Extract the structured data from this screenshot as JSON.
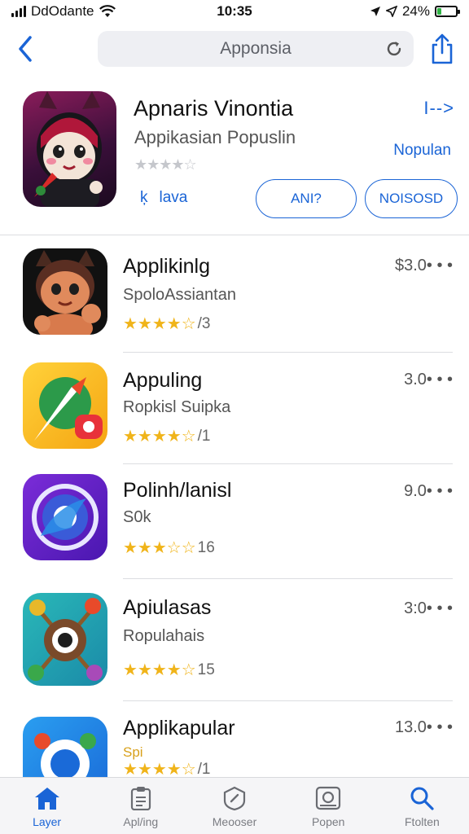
{
  "status_bar": {
    "carrier": "DdOdante",
    "time": "10:35",
    "battery_percent": "24%",
    "battery_level": 0.24
  },
  "nav": {
    "search_text": "Apponsia"
  },
  "featured": {
    "title": "Apnaris Vinontia",
    "subtitle": "Appikasian Popuslin",
    "rating_stars": "★★★★☆",
    "link_glyph": "ķ",
    "link_text": "lava",
    "arrow_text": "I-->",
    "tag": "Nopulan",
    "button_a": "ANI?",
    "button_b": "NOISOSD"
  },
  "apps": [
    {
      "name": "Applikinlg",
      "subtitle": "SpoloAssiantan",
      "stars": "★★★★☆",
      "count": "/3",
      "price": "$3.0• • •",
      "rating": 3.5
    },
    {
      "name": "Appuling",
      "subtitle": "Ropkisl Suipka",
      "stars": "★★★★☆",
      "count": "/1",
      "price": "3.0• • •",
      "rating": 4
    },
    {
      "name": "Polinh/lanisl",
      "subtitle": "S0k",
      "stars": "★★★☆☆",
      "count": "16",
      "price": "9.0• • •",
      "rating": 3.5
    },
    {
      "name": "Apiulasas",
      "subtitle": "Ropulahais",
      "stars": "★★★★☆",
      "count": "15",
      "price": "3:0• • •",
      "rating": 4
    },
    {
      "name": "Applikapular",
      "subtitle": "Spi",
      "stars": "★★★★☆",
      "count": "/1",
      "price": "13.0• • •",
      "rating": 3.5
    }
  ],
  "tabs": [
    {
      "label": "Layer",
      "icon": "home-icon",
      "active": true
    },
    {
      "label": "Apl/ing",
      "icon": "clipboard-icon",
      "active": false
    },
    {
      "label": "Meooser",
      "icon": "shield-icon",
      "active": false
    },
    {
      "label": "Popen",
      "icon": "photo-icon",
      "active": false
    },
    {
      "label": "Ftolten",
      "icon": "search-icon",
      "active": false
    }
  ],
  "colors": {
    "accent": "#1a64d6",
    "star": "#f0b41a",
    "battery": "#2fb344"
  }
}
